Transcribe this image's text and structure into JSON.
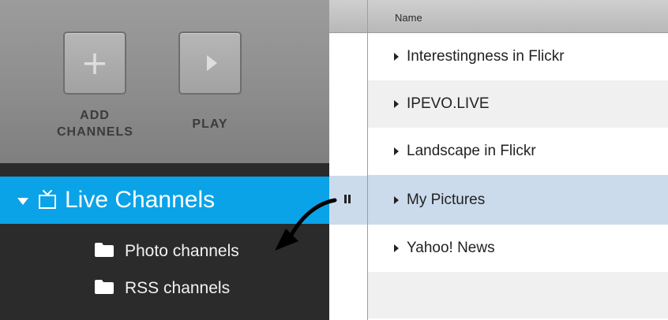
{
  "toolbar": {
    "add_channels": "ADD\nCHANNELS",
    "play": "PLAY"
  },
  "sidebar": {
    "live_channels": "Live Channels",
    "folders": [
      {
        "label": "Photo channels",
        "icon": "folder-icon"
      },
      {
        "label": "RSS channels",
        "icon": "folder-icon"
      }
    ]
  },
  "table": {
    "column_header": "Name",
    "rows": [
      {
        "label": "Interestingness in Flickr"
      },
      {
        "label": "IPEVO.LIVE"
      },
      {
        "label": "Landscape in Flickr"
      },
      {
        "label": "My Pictures",
        "selected": true
      },
      {
        "label": "Yahoo! News"
      }
    ]
  },
  "icons": [
    "plus-icon",
    "play-icon",
    "chevron-down-icon",
    "tv-icon",
    "folder-icon",
    "pause-icon",
    "triangle-right-icon",
    "annotation-arrow-icon"
  ],
  "colors": {
    "accent": "#0aa3e8",
    "sidebar_bg": "#2b2b2b",
    "selected_row": "#cbdbec",
    "alt_row": "#f0f0f0"
  }
}
